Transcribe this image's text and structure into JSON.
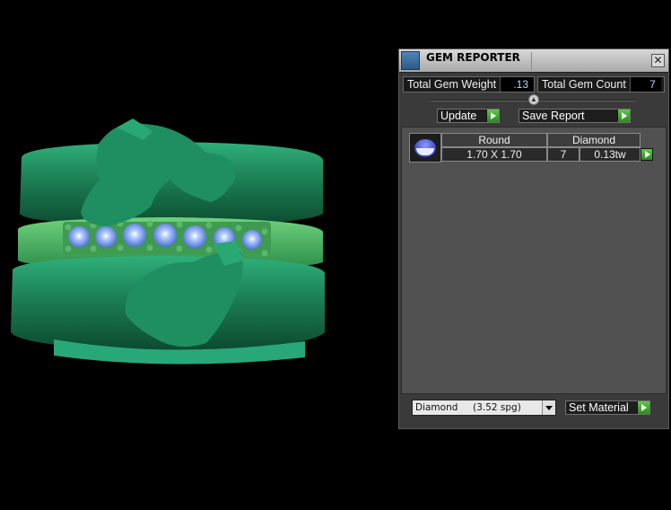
{
  "panel": {
    "title": "GEM REPORTER",
    "close_label": "✕"
  },
  "totals": {
    "weight_label": "Total Gem Weight",
    "weight_value": ".13",
    "count_label": "Total Gem Count",
    "count_value": "7"
  },
  "actions": {
    "update_label": "Update",
    "save_report_label": "Save Report",
    "set_material_label": "Set Material"
  },
  "gems": [
    {
      "shape": "Round",
      "material": "Diamond",
      "size": "1.70 X 1.70",
      "count": "7",
      "weight": "0.13tw",
      "icon": "round-diamond-icon"
    }
  ],
  "material_select": {
    "value": "Diamond     (3.52 spg)"
  },
  "colors": {
    "accent_green": "#3fa82e",
    "value_text": "#bdd3ff",
    "ring_green": "#1f8a5a"
  }
}
